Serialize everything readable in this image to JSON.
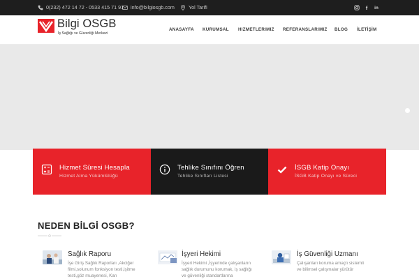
{
  "topbar": {
    "phone": "0(232) 472 14 72 - 0533 415 71 91",
    "email": "info@bilgiosgb.com",
    "directions": "Yol Tarifi",
    "social": [
      "instagram-icon",
      "facebook-icon",
      "linkedin-icon"
    ],
    "social_glyphs": {
      "facebook": "f",
      "linkedin": "in"
    }
  },
  "header": {
    "logo_title": "Bilgi OSGB",
    "logo_subtitle": "İş Sağlığı ve Güvenliği Merkezi",
    "nav": [
      "ANASAYFA",
      "KURUMSAL",
      "HIZMETLERIMIZ",
      "REFERANSLARIMIZ",
      "BLOG",
      "İLETİŞİM"
    ]
  },
  "features": [
    {
      "title": "Hizmet Süresi Hesapla",
      "subtitle": "Hizmet Alma Yükümlülüğü",
      "icon": "calculator-icon"
    },
    {
      "title": "Tehlike Sınıfını Öğren",
      "subtitle": "Tehlike Sınıfları Listesi",
      "icon": "info-icon"
    },
    {
      "title": "İSGB Katip Onayı",
      "subtitle": "İSGB Katip Onayı ve Süreci",
      "icon": "checkmark-icon"
    }
  ],
  "why": {
    "title": "NEDEN BİLGİ OSGB?",
    "services": [
      {
        "title": "Sağlık Raporu",
        "lines": [
          "İşe Giriş Sağlık Raporları ,Akciğer",
          "filmi,solunum fonksiyon testi,işitme",
          "testi,göz muayenesi, Kan"
        ]
      },
      {
        "title": "İşyeri Hekimi",
        "lines": [
          "İşyeri Hekimi ,İşyerinde çalışanların",
          "sağlık durumunu korumak, iş sağlığı",
          "ve güvenliği standartlarına"
        ]
      },
      {
        "title": "İş Güvenliği Uzmanı",
        "lines": [
          "Çalışanları koruma amaçlı sistemli",
          "ve bilimsel çalışmalar yürütür"
        ]
      }
    ]
  },
  "colors": {
    "accent": "#e8232a",
    "dark": "#1a1a1a",
    "topbar": "#1e1e1e",
    "hero": "#e9e9e9"
  }
}
